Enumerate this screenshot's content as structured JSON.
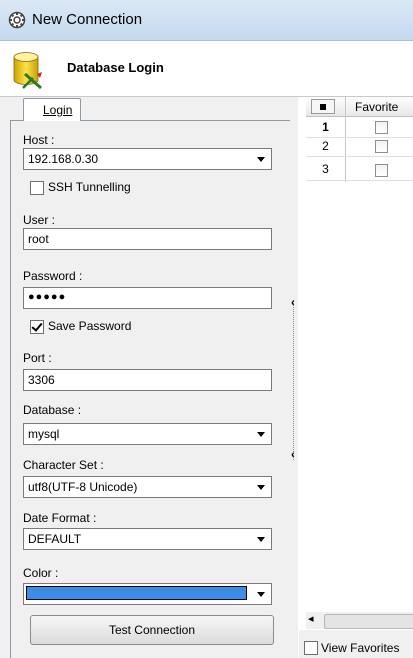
{
  "window": {
    "title": "New Connection"
  },
  "header": {
    "title": "Database Login"
  },
  "tabs": [
    {
      "label": "Login"
    }
  ],
  "form": {
    "host": {
      "label": "Host :",
      "value": "192.168.0.30"
    },
    "ssh": {
      "label": "SSH Tunnelling",
      "checked": false
    },
    "user": {
      "label": "User :",
      "value": "root"
    },
    "password": {
      "label": "Password :",
      "value": "●●●●●"
    },
    "save_password": {
      "label": "Save Password",
      "checked": true
    },
    "port": {
      "label": "Port :",
      "value": "3306"
    },
    "database": {
      "label": "Database :",
      "value": "mysql"
    },
    "charset": {
      "label": "Character Set :",
      "value": "utf8(UTF-8 Unicode)"
    },
    "date_format": {
      "label": "Date Format :",
      "value": "DEFAULT"
    },
    "color": {
      "label": "Color :",
      "value_color": "#3b8ee8"
    },
    "test_button": "Test Connection"
  },
  "grid": {
    "column_header": "Favorite",
    "rows": [
      "1",
      "2",
      "3"
    ]
  },
  "footer": {
    "view_favorites": "View Favorites"
  },
  "colors": {
    "accent": "#3b8ee8"
  }
}
